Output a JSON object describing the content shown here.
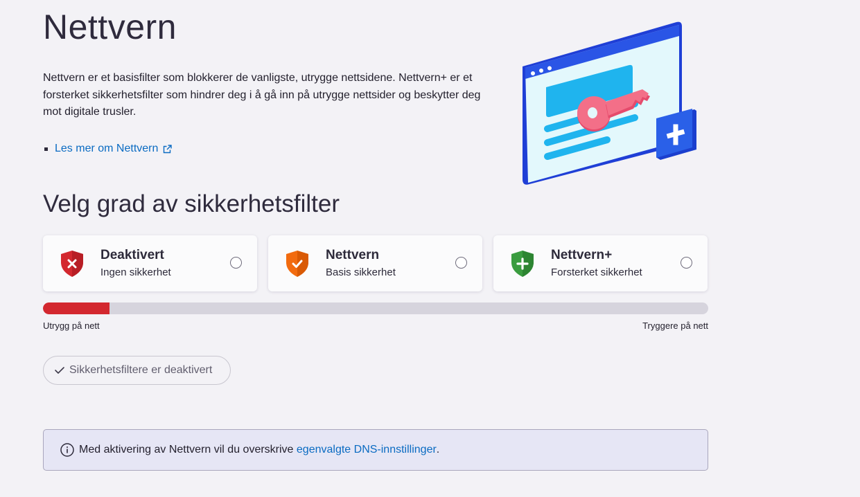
{
  "page": {
    "title": "Nettvern",
    "intro": "Nettvern er et basisfilter som blokkerer de vanligste, utrygge nettsidene. Nettvern+ er et forsterket sikkerhetsfilter som hindrer deg i å gå inn på utrygge nettsider og beskytter deg mot digitale trusler.",
    "link_label": "Les mer om Nettvern"
  },
  "filter": {
    "section_title": "Velg grad av sikkerhetsfilter",
    "options": [
      {
        "title": "Deaktivert",
        "subtitle": "Ingen sikkerhet",
        "color": "#d3282f",
        "icon": "x-shield-icon"
      },
      {
        "title": "Nettvern",
        "subtitle": "Basis sikkerhet",
        "color": "#f26b0f",
        "icon": "check-shield-icon"
      },
      {
        "title": "Nettvern+",
        "subtitle": "Forsterket sikkerhet",
        "color": "#3a9c3f",
        "icon": "plus-shield-icon"
      }
    ],
    "level_fraction": 0.1,
    "level_color": "#d3282f",
    "scale_left": "Utrygg på nett",
    "scale_right": "Tryggere på nett",
    "status": "Sikkerhetsfiltere er deaktivert"
  },
  "info": {
    "text_before": "Med aktivering av Nettvern vil du overskrive",
    "link": "egenvalgte DNS-innstillinger",
    "text_after": "."
  },
  "colors": {
    "accent_link": "#0a6bc2",
    "background": "#f3f2f6"
  }
}
